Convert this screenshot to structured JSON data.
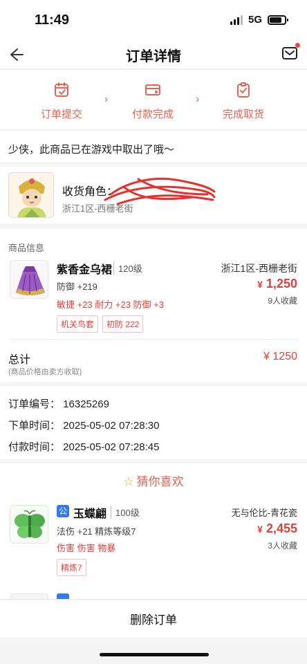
{
  "status": {
    "time": "11:49",
    "network": "5G"
  },
  "header": {
    "title": "订单详情"
  },
  "steps": [
    {
      "label": "订单提交",
      "icon": "calendar-check-icon"
    },
    {
      "label": "付款完成",
      "icon": "card-icon"
    },
    {
      "label": "完成取货",
      "icon": "clipboard-check-icon"
    }
  ],
  "notice": "少侠，此商品已在游戏中取出了哦～",
  "receiver": {
    "label": "收货角色：",
    "server": "浙江1区-西栅老街"
  },
  "goods": {
    "section_title": "商品信息",
    "item": {
      "name": "紫香金乌裙",
      "level": "120级",
      "server": "浙江1区-西栅老街",
      "attr": "防御 +219",
      "currency": "¥",
      "price": "1,250",
      "bonus": "敏捷 +23 耐力 +23 防御 +3",
      "favorites": "9人收藏",
      "tags": [
        "机关鸟套",
        "初防 222"
      ]
    },
    "total_label": "总计",
    "total_note": "(商品价格由卖方收取)",
    "total_value": "¥ 1250"
  },
  "order": {
    "number": "订单编号：  16325269",
    "created": "下单时间：  2025-05-02 07:28:30",
    "paid": "付款时间：  2025-05-02 07:28:45"
  },
  "guess": {
    "title": "猜你喜欢",
    "item": {
      "badge": "公",
      "name": "玉蝶翩",
      "level": "100级",
      "server": "无与伦比-青花瓷",
      "attr": "法伤 +21 精炼等级7",
      "currency": "¥",
      "price": "2,455",
      "bonus": "伤害 伤害 物暴",
      "favorites": "3人收藏",
      "tag": "精炼7"
    }
  },
  "footer": {
    "delete_label": "删除订单"
  },
  "colors": {
    "accent": "#e9624f",
    "price": "#e0403a",
    "badge": "#2f7bef"
  }
}
